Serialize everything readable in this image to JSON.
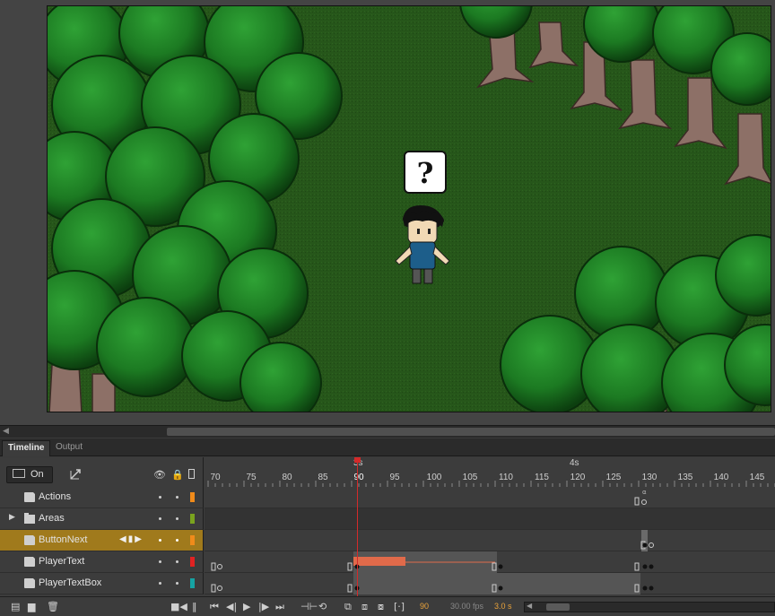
{
  "panel_tabs": [
    {
      "label": "Timeline"
    },
    {
      "label": "Output"
    }
  ],
  "header": {
    "on_label": "On",
    "time_markers": [
      "3s",
      "4s"
    ],
    "frame_ticks": [
      "70",
      "75",
      "80",
      "85",
      "90",
      "95",
      "100",
      "105",
      "110",
      "115",
      "120",
      "125",
      "130",
      "135",
      "140",
      "145"
    ]
  },
  "stage": {
    "speech_bubble_text": "?"
  },
  "layers": [
    {
      "name": "Actions",
      "type": "layer",
      "color": "#f08b1a",
      "selected": false
    },
    {
      "name": "Areas",
      "type": "folder",
      "color": "#7aa31e",
      "selected": false
    },
    {
      "name": "ButtonNext",
      "type": "layer",
      "color": "#f08b1a",
      "selected": true
    },
    {
      "name": "PlayerText",
      "type": "layer",
      "color": "#e02222",
      "selected": false
    },
    {
      "name": "PlayerTextBox",
      "type": "layer",
      "color": "#16a3a3",
      "selected": false
    }
  ],
  "footer": {
    "current_frame": "90",
    "fps": "30.00 fps",
    "elapsed": "3.0 s"
  },
  "colors": {
    "playhead": "#d42a2a",
    "selected_layer": "#a07a1c",
    "tween": "#e06a4a"
  }
}
